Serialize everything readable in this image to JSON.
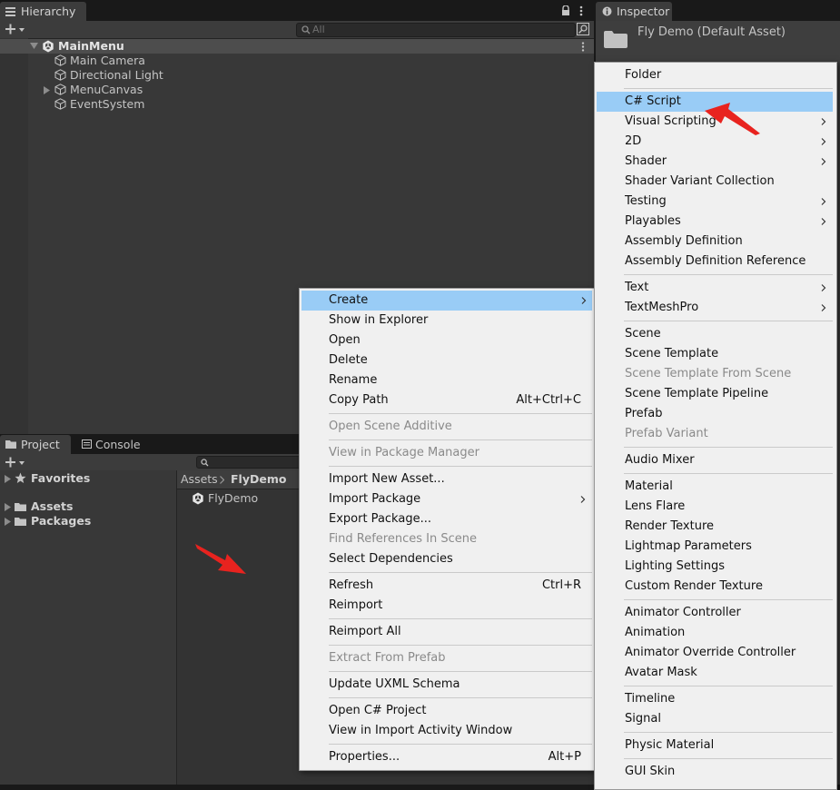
{
  "hierarchy": {
    "tab_label": "Hierarchy",
    "search_placeholder": "All",
    "scene": "MainMenu",
    "objects": [
      "Main Camera",
      "Directional Light",
      "MenuCanvas",
      "EventSystem"
    ]
  },
  "inspector": {
    "tab_label": "Inspector",
    "title": "Fly Demo (Default Asset)"
  },
  "project": {
    "tab_label": "Project",
    "console_tab_label": "Console",
    "favorites": "Favorites",
    "assets": "Assets",
    "packages": "Packages",
    "breadcrumb_root": "Assets",
    "breadcrumb_current": "FlyDemo",
    "item": "FlyDemo"
  },
  "context_menu": {
    "items": [
      {
        "label": "Create"
      },
      {
        "label": "Show in Explorer"
      },
      {
        "label": "Open"
      },
      {
        "label": "Delete"
      },
      {
        "label": "Rename"
      },
      {
        "label": "Copy Path",
        "shortcut": "Alt+Ctrl+C"
      },
      {
        "label": "Open Scene Additive"
      },
      {
        "label": "View in Package Manager"
      },
      {
        "label": "Import New Asset..."
      },
      {
        "label": "Import Package"
      },
      {
        "label": "Export Package..."
      },
      {
        "label": "Find References In Scene"
      },
      {
        "label": "Select Dependencies"
      },
      {
        "label": "Refresh",
        "shortcut": "Ctrl+R"
      },
      {
        "label": "Reimport"
      },
      {
        "label": "Reimport All"
      },
      {
        "label": "Extract From Prefab"
      },
      {
        "label": "Update UXML Schema"
      },
      {
        "label": "Open C# Project"
      },
      {
        "label": "View in Import Activity Window"
      },
      {
        "label": "Properties...",
        "shortcut": "Alt+P"
      }
    ]
  },
  "create_menu": {
    "items": [
      {
        "label": "Folder"
      },
      {
        "label": "C# Script"
      },
      {
        "label": "Visual Scripting"
      },
      {
        "label": "2D"
      },
      {
        "label": "Shader"
      },
      {
        "label": "Shader Variant Collection"
      },
      {
        "label": "Testing"
      },
      {
        "label": "Playables"
      },
      {
        "label": "Assembly Definition"
      },
      {
        "label": "Assembly Definition Reference"
      },
      {
        "label": "Text"
      },
      {
        "label": "TextMeshPro"
      },
      {
        "label": "Scene"
      },
      {
        "label": "Scene Template"
      },
      {
        "label": "Scene Template From Scene"
      },
      {
        "label": "Scene Template Pipeline"
      },
      {
        "label": "Prefab"
      },
      {
        "label": "Prefab Variant"
      },
      {
        "label": "Audio Mixer"
      },
      {
        "label": "Material"
      },
      {
        "label": "Lens Flare"
      },
      {
        "label": "Render Texture"
      },
      {
        "label": "Lightmap Parameters"
      },
      {
        "label": "Lighting Settings"
      },
      {
        "label": "Custom Render Texture"
      },
      {
        "label": "Animator Controller"
      },
      {
        "label": "Animation"
      },
      {
        "label": "Animator Override Controller"
      },
      {
        "label": "Avatar Mask"
      },
      {
        "label": "Timeline"
      },
      {
        "label": "Signal"
      },
      {
        "label": "Physic Material"
      },
      {
        "label": "GUI Skin"
      }
    ]
  },
  "colors": {
    "highlight": "#99ccf6",
    "annotation_arrow": "#e8231f",
    "menu_bg": "#f0f0f0"
  }
}
